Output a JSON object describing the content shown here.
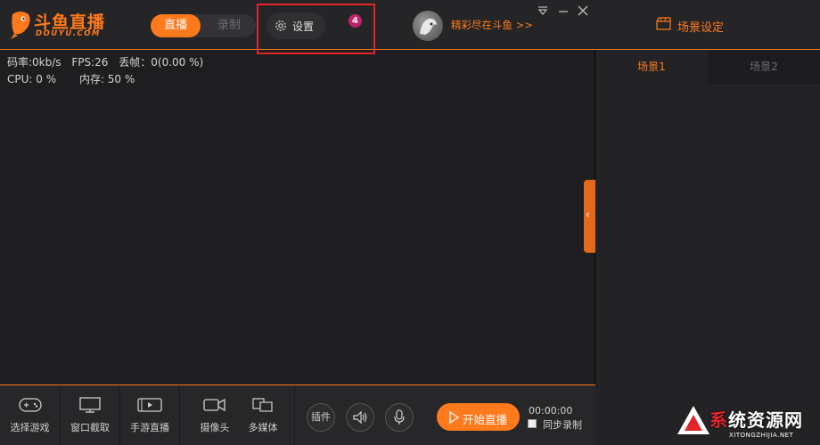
{
  "app": {
    "logo_title": "斗鱼直播",
    "logo_subtitle": "DOUYU.COM"
  },
  "header": {
    "mode_live_label": "直播",
    "mode_record_label": "录制",
    "settings_label": "设置",
    "step_badge": "4",
    "promo_link": "精彩尽在斗鱼 >>"
  },
  "stats": {
    "bitrate": "码率:0kb/s",
    "fps": "FPS:26",
    "dropped": "丢帧：0(0.00 %)",
    "cpu": "CPU: 0 %",
    "memory": "内存: 50 %"
  },
  "toolbar": {
    "tools": [
      {
        "label": "选择游戏",
        "icon": "gamepad-icon"
      },
      {
        "label": "窗口截取",
        "icon": "monitor-icon"
      },
      {
        "label": "手游直播",
        "icon": "mobile-play-icon"
      },
      {
        "label": "摄像头",
        "icon": "camera-icon"
      },
      {
        "label": "多媒体",
        "icon": "media-icon"
      }
    ],
    "plugin_label": "插件",
    "start_label": "开始直播",
    "timer": "00:00:00",
    "sync_record_label": "同步录制"
  },
  "scene_panel": {
    "title": "场景设定",
    "tabs": [
      "场景1",
      "场景2"
    ]
  },
  "watermark": {
    "text_prefix": "系",
    "text_rest": "统资源网",
    "url": "XITONGZHIJIA.NET"
  },
  "colors": {
    "accent": "#ff7a1c",
    "highlight": "#e3242b",
    "badge": "#c2216b"
  }
}
